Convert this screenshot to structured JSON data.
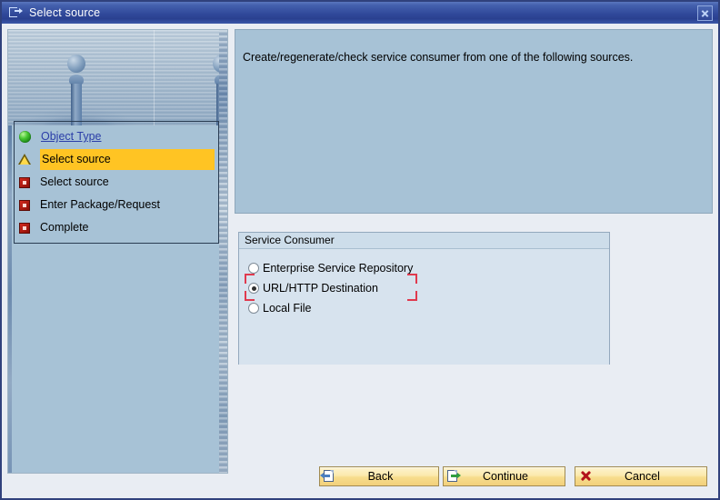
{
  "window": {
    "title": "Select source",
    "title_icon": "export-window-icon",
    "close_icon": "close-icon"
  },
  "roadmap": {
    "steps": [
      {
        "label": "Object Type",
        "icon": "green-led-icon",
        "state": "done"
      },
      {
        "label": "Select source",
        "icon": "warning-triangle-icon",
        "state": "current"
      },
      {
        "label": "Select source",
        "icon": "red-square-icon",
        "state": "pending"
      },
      {
        "label": "Enter Package/Request",
        "icon": "red-square-icon",
        "state": "pending"
      },
      {
        "label": "Complete",
        "icon": "red-square-icon",
        "state": "pending"
      }
    ]
  },
  "content": {
    "description": "Create/regenerate/check service consumer from one of the following sources."
  },
  "group": {
    "title": "Service Consumer",
    "options": [
      {
        "label": "Enterprise Service Repository",
        "selected": false
      },
      {
        "label": "URL/HTTP Destination",
        "selected": true
      },
      {
        "label": "Local File",
        "selected": false
      }
    ]
  },
  "footer": {
    "back_label": "Back",
    "back_icon": "page-back-icon",
    "continue_label": "Continue",
    "continue_icon": "page-forward-icon",
    "cancel_label": "Cancel",
    "cancel_icon": "red-x-icon"
  },
  "colors": {
    "titlebar": "#31499a",
    "sidepanel": "#a7c2d6",
    "highlight": "#ffc423",
    "focus_bracket": "#e03a4e",
    "button": "#fbe9ad"
  }
}
